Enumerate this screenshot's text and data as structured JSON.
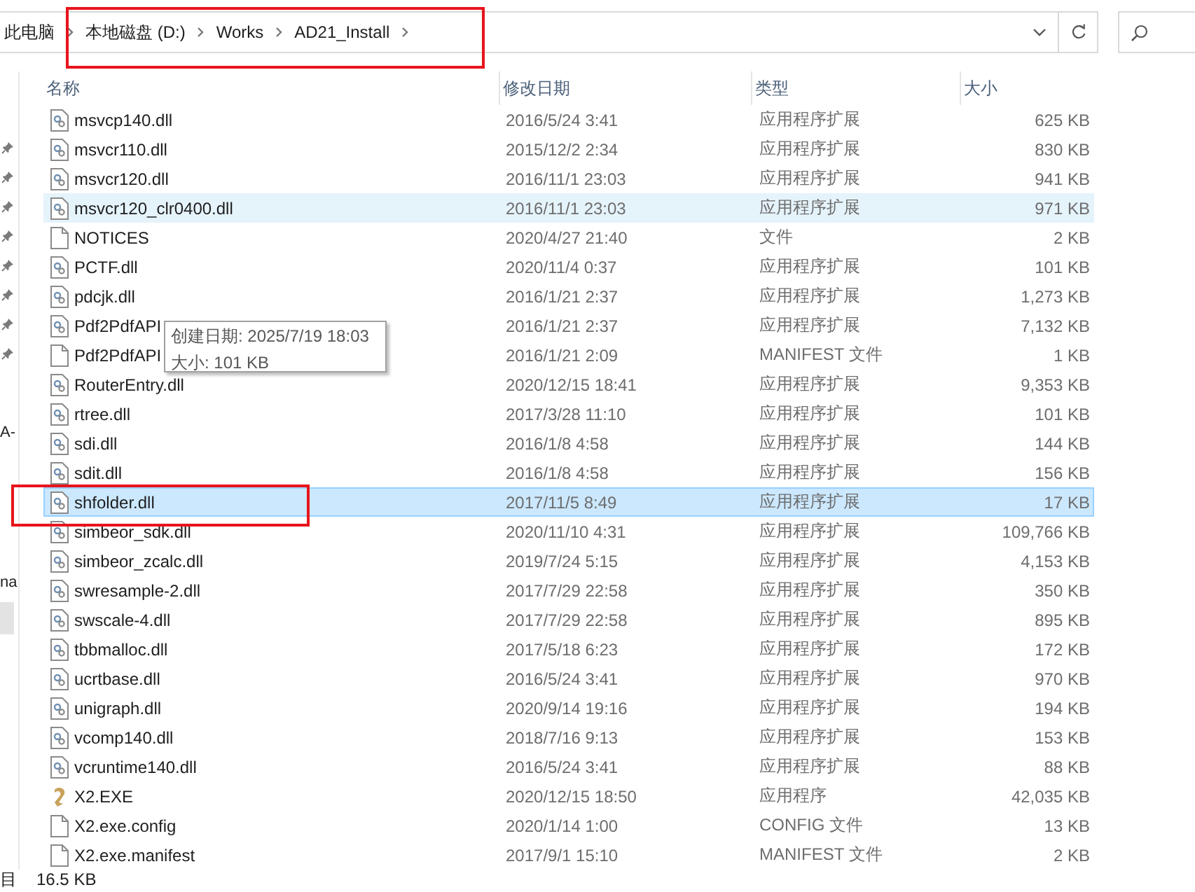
{
  "address_bar": {
    "root": "此电脑",
    "path": [
      "本地磁盘 (D:)",
      "Works",
      "AD21_Install"
    ]
  },
  "nav_pane": {
    "pinned_count_items": [
      {
        "pinned": true
      },
      {
        "pinned": true
      },
      {
        "pinned": true
      },
      {
        "pinned": true
      },
      {
        "pinned": true
      },
      {
        "pinned": true
      },
      {
        "pinned": true
      },
      {
        "pinned": true
      }
    ],
    "labels": [
      "A-",
      "na"
    ]
  },
  "table": {
    "columns": [
      "名称",
      "修改日期",
      "类型",
      "大小"
    ],
    "rows": [
      {
        "kind": "dll",
        "name": "msvcp140.dll",
        "date": "2016/5/24 3:41",
        "type": "应用程序扩展",
        "size": "625 KB",
        "hover": false,
        "selected": false
      },
      {
        "kind": "dll",
        "name": "msvcr110.dll",
        "date": "2015/12/2 2:34",
        "type": "应用程序扩展",
        "size": "830 KB",
        "hover": false,
        "selected": false
      },
      {
        "kind": "dll",
        "name": "msvcr120.dll",
        "date": "2016/11/1 23:03",
        "type": "应用程序扩展",
        "size": "941 KB",
        "hover": false,
        "selected": false
      },
      {
        "kind": "dll",
        "name": "msvcr120_clr0400.dll",
        "date": "2016/11/1 23:03",
        "type": "应用程序扩展",
        "size": "971 KB",
        "hover": true,
        "selected": false
      },
      {
        "kind": "file",
        "name": "NOTICES",
        "date": "2020/4/27 21:40",
        "type": "文件",
        "size": "2 KB",
        "hover": false,
        "selected": false
      },
      {
        "kind": "dll",
        "name": "PCTF.dll",
        "date": "2020/11/4 0:37",
        "type": "应用程序扩展",
        "size": "101 KB",
        "hover": false,
        "selected": false
      },
      {
        "kind": "dll",
        "name": "pdcjk.dll",
        "date": "2016/1/21 2:37",
        "type": "应用程序扩展",
        "size": "1,273 KB",
        "hover": false,
        "selected": false
      },
      {
        "kind": "dll",
        "name": "Pdf2PdfAPI",
        "date": "2016/1/21 2:37",
        "type": "应用程序扩展",
        "size": "7,132 KB",
        "hover": false,
        "selected": false
      },
      {
        "kind": "file",
        "name": "Pdf2PdfAPI",
        "date": "2016/1/21 2:09",
        "type": "MANIFEST 文件",
        "size": "1 KB",
        "hover": false,
        "selected": false
      },
      {
        "kind": "dll",
        "name": "RouterEntry.dll",
        "date": "2020/12/15 18:41",
        "type": "应用程序扩展",
        "size": "9,353 KB",
        "hover": false,
        "selected": false
      },
      {
        "kind": "dll",
        "name": "rtree.dll",
        "date": "2017/3/28 11:10",
        "type": "应用程序扩展",
        "size": "101 KB",
        "hover": false,
        "selected": false
      },
      {
        "kind": "dll",
        "name": "sdi.dll",
        "date": "2016/1/8 4:58",
        "type": "应用程序扩展",
        "size": "144 KB",
        "hover": false,
        "selected": false
      },
      {
        "kind": "dll",
        "name": "sdit.dll",
        "date": "2016/1/8 4:58",
        "type": "应用程序扩展",
        "size": "156 KB",
        "hover": false,
        "selected": false
      },
      {
        "kind": "dll",
        "name": "shfolder.dll",
        "date": "2017/11/5 8:49",
        "type": "应用程序扩展",
        "size": "17 KB",
        "hover": false,
        "selected": true
      },
      {
        "kind": "dll",
        "name": "simbeor_sdk.dll",
        "date": "2020/11/10 4:31",
        "type": "应用程序扩展",
        "size": "109,766 KB",
        "hover": false,
        "selected": false
      },
      {
        "kind": "dll",
        "name": "simbeor_zcalc.dll",
        "date": "2019/7/24 5:15",
        "type": "应用程序扩展",
        "size": "4,153 KB",
        "hover": false,
        "selected": false
      },
      {
        "kind": "dll",
        "name": "swresample-2.dll",
        "date": "2017/7/29 22:58",
        "type": "应用程序扩展",
        "size": "350 KB",
        "hover": false,
        "selected": false
      },
      {
        "kind": "dll",
        "name": "swscale-4.dll",
        "date": "2017/7/29 22:58",
        "type": "应用程序扩展",
        "size": "895 KB",
        "hover": false,
        "selected": false
      },
      {
        "kind": "dll",
        "name": "tbbmalloc.dll",
        "date": "2017/5/18 6:23",
        "type": "应用程序扩展",
        "size": "172 KB",
        "hover": false,
        "selected": false
      },
      {
        "kind": "dll",
        "name": "ucrtbase.dll",
        "date": "2016/5/24 3:41",
        "type": "应用程序扩展",
        "size": "970 KB",
        "hover": false,
        "selected": false
      },
      {
        "kind": "dll",
        "name": "unigraph.dll",
        "date": "2020/9/14 19:16",
        "type": "应用程序扩展",
        "size": "194 KB",
        "hover": false,
        "selected": false
      },
      {
        "kind": "dll",
        "name": "vcomp140.dll",
        "date": "2018/7/16 9:13",
        "type": "应用程序扩展",
        "size": "153 KB",
        "hover": false,
        "selected": false
      },
      {
        "kind": "dll",
        "name": "vcruntime140.dll",
        "date": "2016/5/24 3:41",
        "type": "应用程序扩展",
        "size": "88 KB",
        "hover": false,
        "selected": false
      },
      {
        "kind": "exe",
        "name": "X2.EXE",
        "date": "2020/12/15 18:50",
        "type": "应用程序",
        "size": "42,035 KB",
        "hover": false,
        "selected": false
      },
      {
        "kind": "file",
        "name": "X2.exe.config",
        "date": "2020/1/14 1:00",
        "type": "CONFIG 文件",
        "size": "13 KB",
        "hover": false,
        "selected": false
      },
      {
        "kind": "file",
        "name": "X2.exe.manifest",
        "date": "2017/9/1 15:10",
        "type": "MANIFEST 文件",
        "size": "2 KB",
        "hover": false,
        "selected": false
      }
    ]
  },
  "tooltip": {
    "lines": [
      "创建日期: 2025/7/19 18:03",
      "大小: 101 KB"
    ]
  },
  "status_bar": {
    "items": [
      "目",
      "16.5 KB"
    ]
  }
}
